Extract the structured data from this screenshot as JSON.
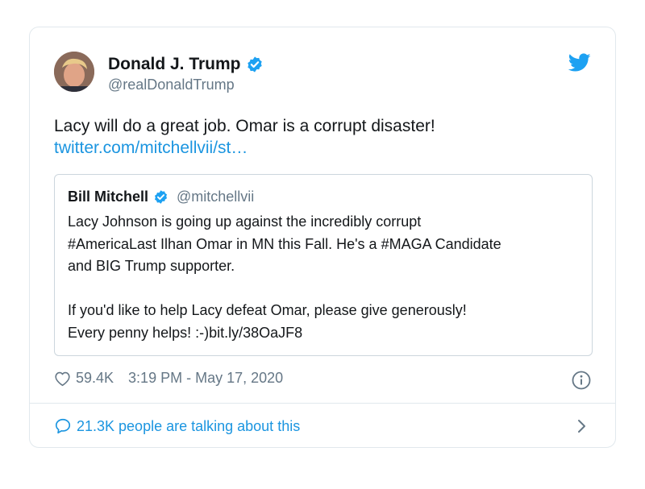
{
  "tweet": {
    "author_name": "Donald J. Trump",
    "author_handle": "@realDonaldTrump",
    "text": "Lacy will do a great job. Omar is a corrupt disaster!",
    "link_text": "twitter.com/mitchellvii/st…",
    "likes": "59.4K",
    "timestamp": "3:19 PM - May 17, 2020",
    "talking": "21.3K people are talking about this"
  },
  "quoted": {
    "author_name": "Bill Mitchell",
    "author_handle": "@mitchellvii",
    "paragraph1": "Lacy Johnson is going up against the incredibly corrupt\n#AmericaLast Ilhan Omar in MN this Fall. He's a #MAGA Candidate\nand BIG Trump supporter.",
    "paragraph2": "If you'd like to help Lacy defeat Omar, please give generously!\nEvery penny helps! :-)bit.ly/38OaJF8"
  },
  "icons": {
    "verified": "verified-badge-icon",
    "bird": "twitter-bird-icon",
    "heart": "heart-icon",
    "info": "info-icon",
    "bubble": "speech-bubble-icon",
    "chevron": "chevron-right-icon"
  },
  "colors": {
    "link_blue": "#1b95e0",
    "muted": "#657786",
    "border": "#e1e8ed"
  }
}
